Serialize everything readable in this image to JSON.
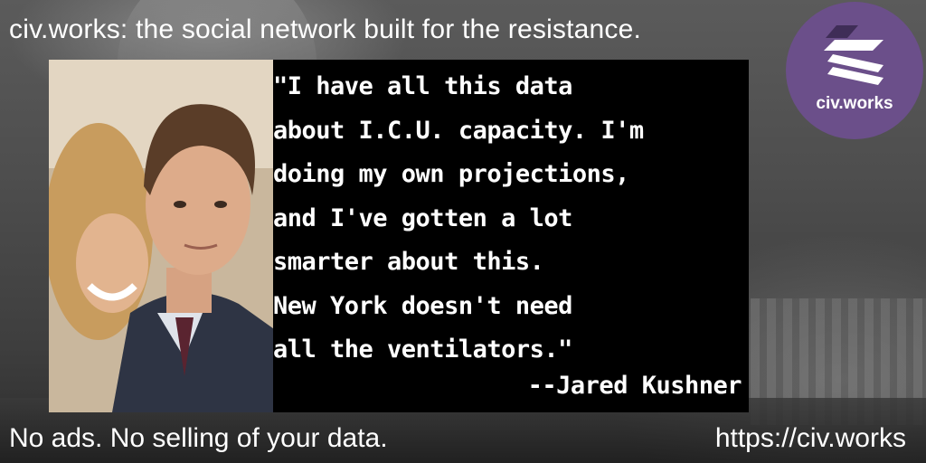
{
  "header": {
    "headline": "civ.works: the social network built for the resistance."
  },
  "logo": {
    "label": "civ.works",
    "icon": "civworks-logo-icon",
    "background_color": "#6b4f8a"
  },
  "quote": {
    "text": "\"I have all this data\nabout I.C.U. capacity. I'm\ndoing my own projections,\nand I've gotten a lot\nsmarter about this.\nNew York doesn't need\nall the ventilators.\"",
    "attribution": "--Jared Kushner"
  },
  "footer": {
    "tagline": "No ads. No selling of your data.",
    "url": "https://civ.works"
  }
}
